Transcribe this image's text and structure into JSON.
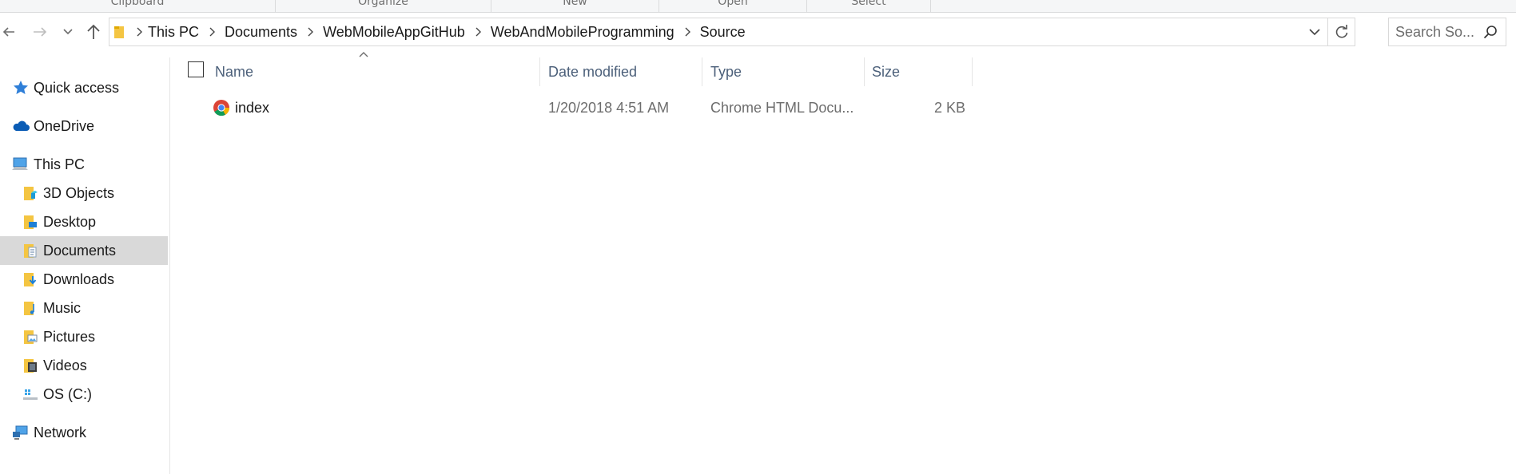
{
  "ribbon": {
    "groups": [
      "Clipboard",
      "Organize",
      "New",
      "Open",
      "Select"
    ]
  },
  "navigation": {
    "back_icon": "back-arrow-icon",
    "forward_icon": "forward-arrow-icon",
    "recent_icon": "chevron-down-icon",
    "up_icon": "up-arrow-icon"
  },
  "address": {
    "breadcrumbs": [
      "This PC",
      "Documents",
      "WebMobileAppGitHub",
      "WebAndMobileProgramming",
      "Source"
    ]
  },
  "search": {
    "placeholder": "Search So..."
  },
  "sidebar": {
    "items": [
      {
        "label": "Quick access",
        "icon": "star-icon"
      },
      {
        "label": "OneDrive",
        "icon": "cloud-icon"
      },
      {
        "label": "This PC",
        "icon": "computer-icon"
      },
      {
        "label": "3D Objects",
        "icon": "folder-3d-icon"
      },
      {
        "label": "Desktop",
        "icon": "folder-desktop-icon"
      },
      {
        "label": "Documents",
        "icon": "folder-documents-icon"
      },
      {
        "label": "Downloads",
        "icon": "folder-downloads-icon"
      },
      {
        "label": "Music",
        "icon": "folder-music-icon"
      },
      {
        "label": "Pictures",
        "icon": "folder-pictures-icon"
      },
      {
        "label": "Videos",
        "icon": "folder-videos-icon"
      },
      {
        "label": "OS (C:)",
        "icon": "drive-icon"
      },
      {
        "label": "Network",
        "icon": "network-icon"
      }
    ],
    "selected": "Documents"
  },
  "columns": {
    "name": "Name",
    "date_modified": "Date modified",
    "type": "Type",
    "size": "Size"
  },
  "files": [
    {
      "name": "index",
      "date_modified": "1/20/2018 4:51 AM",
      "type": "Chrome HTML Docu...",
      "size": "2 KB",
      "icon": "chrome-icon"
    }
  ],
  "colors": {
    "header_text": "#4c607a",
    "selection": "#d9d9d9",
    "muted_text": "#6d6d6d"
  }
}
